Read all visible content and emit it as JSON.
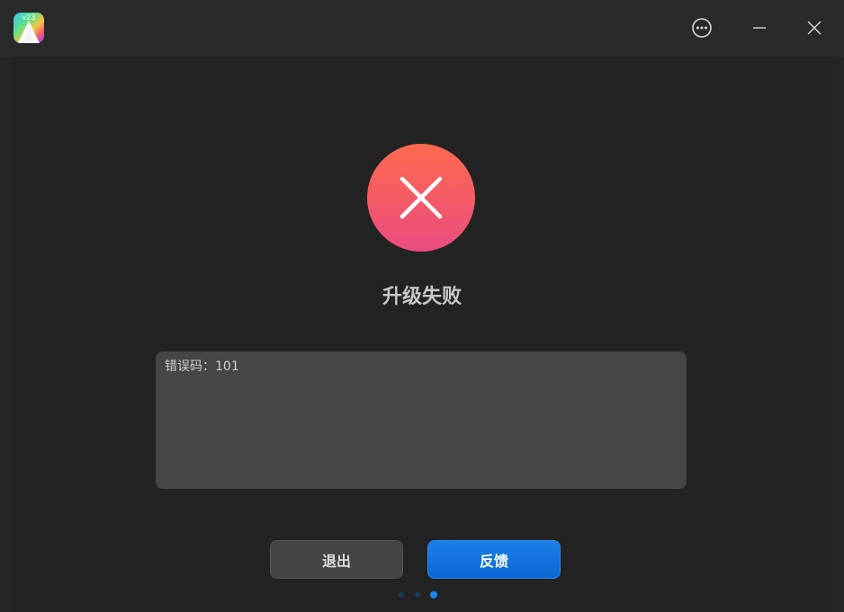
{
  "app": {
    "logo_text": "v23",
    "logo_icon": "upgrade-arrow-icon"
  },
  "titlebar": {
    "menu_icon": "more-options-icon",
    "minimize_icon": "minimize-icon",
    "close_icon": "close-icon"
  },
  "status": {
    "icon": "error-x-icon",
    "title": "升级失败",
    "colors": {
      "gradient_top": "#ff6a4d",
      "gradient_bottom": "#e94c80"
    }
  },
  "error_details": {
    "text": "错误码：101"
  },
  "buttons": {
    "exit_label": "退出",
    "feedback_label": "反馈",
    "feedback_color": "#0b6fe0"
  },
  "progress": {
    "total_steps": 3,
    "current_step": 3,
    "active_color": "#1f86f0"
  }
}
